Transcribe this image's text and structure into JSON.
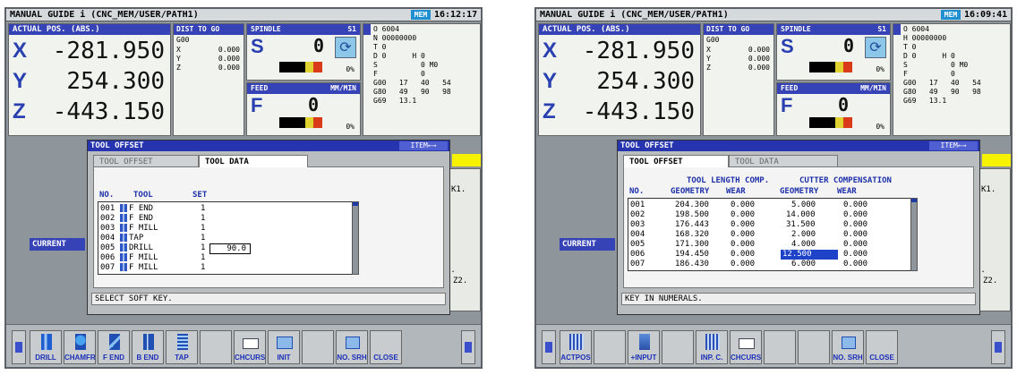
{
  "left": {
    "title": "MANUAL GUIDE i  (CNC_MEM/USER/PATH1)",
    "mode": "MEM",
    "time": "16:12:17",
    "pos_header": "ACTUAL POS. (ABS.)",
    "axes": [
      {
        "axis": "X",
        "value": "-281.950"
      },
      {
        "axis": "Y",
        "value": "254.300"
      },
      {
        "axis": "Z",
        "value": "-443.150"
      }
    ],
    "dtg": {
      "header": "DIST TO GO",
      "gcode": "G00",
      "rows": [
        {
          "a": "X",
          "v": "0.000"
        },
        {
          "a": "Y",
          "v": "0.000"
        },
        {
          "a": "Z",
          "v": "0.000"
        }
      ]
    },
    "spindle": {
      "header": "SPINDLE",
      "id": "S1",
      "letter": "S",
      "value": "0",
      "pct": "0%"
    },
    "feed": {
      "header": "FEED",
      "unit": "MM/MIN",
      "letter": "F",
      "value": "0",
      "pct": "0%"
    },
    "modal": [
      "O 6004",
      "N 00000000",
      "T 0",
      "D 0      H 0",
      "S          0 M0",
      "F          0",
      "G00   17   40   54",
      "G80   49   90   98",
      "G69   13.1"
    ],
    "current": "CURRENT",
    "right_panel": {
      "k1": "K1.",
      "b": "B.",
      "z": "Z2."
    },
    "dialog": {
      "title": "TOOL OFFSET",
      "item": "ITEM←→",
      "tabs": [
        "TOOL OFFSET",
        "TOOL DATA"
      ],
      "headers": [
        "NO.",
        "TOOL",
        "SET"
      ],
      "rows": [
        {
          "no": "001",
          "tool": "F END",
          "set": "1"
        },
        {
          "no": "002",
          "tool": "F END",
          "set": "1"
        },
        {
          "no": "003",
          "tool": "F MILL",
          "set": "1"
        },
        {
          "no": "004",
          "tool": "TAP",
          "set": "1"
        },
        {
          "no": "005",
          "tool": "DRILL",
          "set": "1"
        },
        {
          "no": "006",
          "tool": "F MILL",
          "set": "1"
        },
        {
          "no": "007",
          "tool": "F MILL",
          "set": "1"
        }
      ],
      "input_value": "90.0",
      "status": "SELECT SOFT KEY."
    },
    "softkeys": [
      "DRILL",
      "CHAMFR",
      "F END",
      "B END",
      "TAP",
      "",
      "CHCURS",
      "INIT",
      "",
      "NO. SRH",
      "CLOSE"
    ]
  },
  "right": {
    "title": "MANUAL GUIDE i  (CNC_MEM/USER/PATH1)",
    "mode": "MEM",
    "time": "16:09:41",
    "pos_header": "ACTUAL POS. (ABS.)",
    "axes": [
      {
        "axis": "X",
        "value": "-281.950"
      },
      {
        "axis": "Y",
        "value": "254.300"
      },
      {
        "axis": "Z",
        "value": "-443.150"
      }
    ],
    "dtg": {
      "header": "DIST TO GO",
      "gcode": "G00",
      "rows": [
        {
          "a": "X",
          "v": "0.000"
        },
        {
          "a": "Y",
          "v": "0.000"
        },
        {
          "a": "Z",
          "v": "0.000"
        }
      ]
    },
    "spindle": {
      "header": "SPINDLE",
      "id": "S1",
      "letter": "S",
      "value": "0",
      "pct": "0%"
    },
    "feed": {
      "header": "FEED",
      "unit": "MM/MIN",
      "letter": "F",
      "value": "0",
      "pct": "0%"
    },
    "modal": [
      "O 6004",
      "H 00000000",
      "T 0",
      "D 0      H 0",
      "S          0 M0",
      "F          0",
      "G00   17   40   54",
      "G80   49   90   98",
      "G69   13.1"
    ],
    "current": "CURRENT",
    "right_panel": {
      "k1": "K1.",
      "b": "B.",
      "z": "Z2."
    },
    "dialog": {
      "title": "TOOL OFFSET",
      "item": "ITEM←→",
      "tabs": [
        "TOOL OFFSET",
        "TOOL DATA"
      ],
      "group_headers": [
        "TOOL LENGTH COMP.",
        "CUTTER COMPENSATION"
      ],
      "headers": [
        "NO.",
        "GEOMETRY",
        "WEAR",
        "GEOMETRY",
        "WEAR"
      ],
      "rows": [
        {
          "no": "001",
          "lg": "204.300",
          "lw": "0.000",
          "cg": "5.000",
          "cw": "0.000"
        },
        {
          "no": "002",
          "lg": "198.500",
          "lw": "0.000",
          "cg": "14.000",
          "cw": "0.000"
        },
        {
          "no": "003",
          "lg": "176.443",
          "lw": "0.000",
          "cg": "31.500",
          "cw": "0.000"
        },
        {
          "no": "004",
          "lg": "168.320",
          "lw": "0.000",
          "cg": "2.000",
          "cw": "0.000"
        },
        {
          "no": "005",
          "lg": "171.300",
          "lw": "0.000",
          "cg": "4.000",
          "cw": "0.000"
        },
        {
          "no": "006",
          "lg": "194.450",
          "lw": "0.000",
          "cg": "12.500",
          "cw": "0.000"
        },
        {
          "no": "007",
          "lg": "186.430",
          "lw": "0.000",
          "cg": "6.000",
          "cw": "0.000"
        }
      ],
      "status": "KEY IN NUMERALS."
    },
    "softkeys": [
      "ACTPOS",
      "",
      "+INPUT",
      "",
      "INP. C.",
      "CHCURS",
      "",
      "",
      "NO. SRH",
      "CLOSE"
    ]
  }
}
